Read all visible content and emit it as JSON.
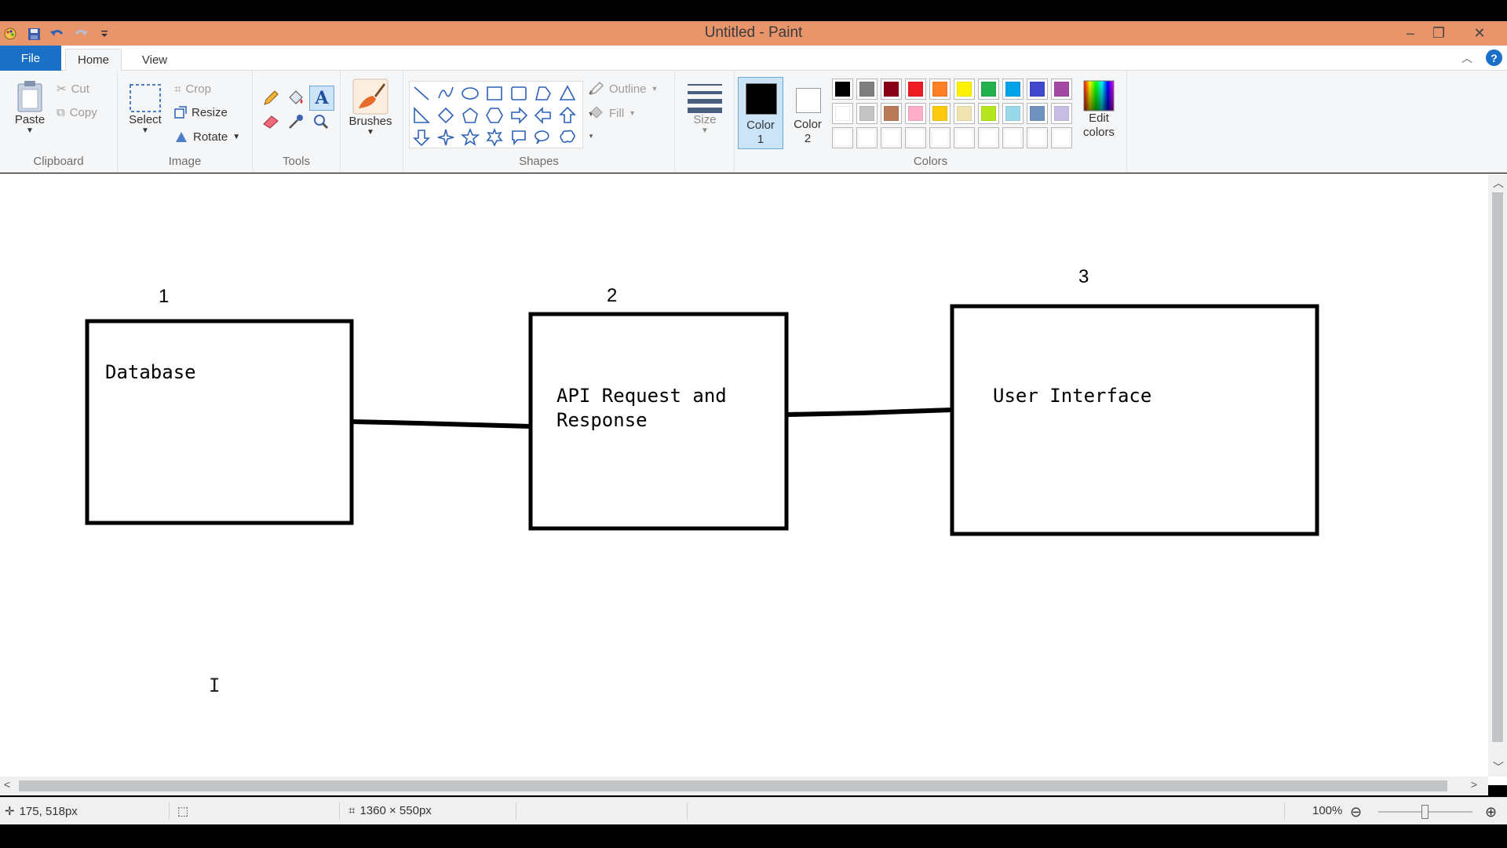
{
  "window": {
    "title": "Untitled - Paint",
    "controls": {
      "minimize": "–",
      "restore": "❐",
      "close": "✕"
    }
  },
  "quick_access": [
    "paint-app-icon",
    "save-icon",
    "undo-icon",
    "redo-icon",
    "customize-icon"
  ],
  "tabs": {
    "file": "File",
    "home": "Home",
    "view": "View"
  },
  "ribbon": {
    "clipboard": {
      "label": "Clipboard",
      "paste": "Paste",
      "cut": "Cut",
      "copy": "Copy"
    },
    "image": {
      "label": "Image",
      "select": "Select",
      "crop": "Crop",
      "resize": "Resize",
      "rotate": "Rotate"
    },
    "tools": {
      "label": "Tools"
    },
    "brushes": {
      "label": "Brushes"
    },
    "shapes": {
      "label": "Shapes",
      "outline": "Outline",
      "fill": "Fill"
    },
    "size": {
      "label": "Size"
    },
    "colors": {
      "label": "Colors",
      "color1": [
        "Color",
        "1"
      ],
      "color2": [
        "Color",
        "2"
      ],
      "color1_value": "#000000",
      "color2_value": "#ffffff",
      "edit": [
        "Edit",
        "colors"
      ],
      "palette_row1": [
        "#000000",
        "#7f7f7f",
        "#880015",
        "#ed1c24",
        "#ff7f27",
        "#fff200",
        "#22b14c",
        "#00a2e8",
        "#3f48cc",
        "#a349a4"
      ],
      "palette_row2": [
        "#ffffff",
        "#c3c3c3",
        "#b97a57",
        "#ffaec9",
        "#ffc90e",
        "#efe4b0",
        "#b5e61d",
        "#99d9ea",
        "#7092be",
        "#c8bfe7"
      ],
      "palette_row3": [
        "#ffffff",
        "#ffffff",
        "#ffffff",
        "#ffffff",
        "#ffffff",
        "#ffffff",
        "#ffffff",
        "#ffffff",
        "#ffffff",
        "#ffffff"
      ]
    }
  },
  "diagram": {
    "box1": {
      "number": "1",
      "text": "Database"
    },
    "box2": {
      "number": "2",
      "text": "API Request and\nResponse"
    },
    "box3": {
      "number": "3",
      "text": "User Interface"
    }
  },
  "status": {
    "cursor_pos": "175, 518px",
    "canvas_size": "1360 × 550px",
    "zoom": "100%",
    "zoom_level": 1.0
  }
}
